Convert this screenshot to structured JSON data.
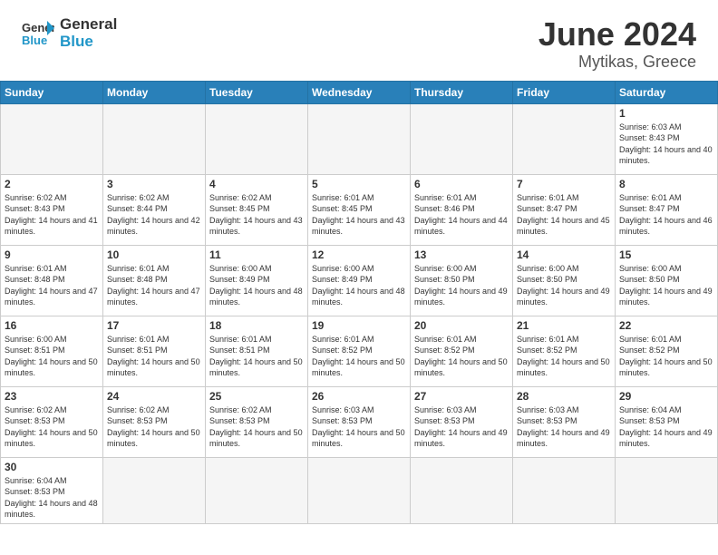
{
  "header": {
    "logo_general": "General",
    "logo_blue": "Blue",
    "title": "June 2024",
    "subtitle": "Mytikas, Greece"
  },
  "weekdays": [
    "Sunday",
    "Monday",
    "Tuesday",
    "Wednesday",
    "Thursday",
    "Friday",
    "Saturday"
  ],
  "weeks": [
    [
      {
        "day": "",
        "empty": true
      },
      {
        "day": "",
        "empty": true
      },
      {
        "day": "",
        "empty": true
      },
      {
        "day": "",
        "empty": true
      },
      {
        "day": "",
        "empty": true
      },
      {
        "day": "",
        "empty": true
      },
      {
        "day": "1",
        "sunrise": "6:03 AM",
        "sunset": "8:43 PM",
        "daylight": "14 hours and 40 minutes."
      }
    ],
    [
      {
        "day": "2",
        "sunrise": "6:02 AM",
        "sunset": "8:43 PM",
        "daylight": "14 hours and 41 minutes."
      },
      {
        "day": "3",
        "sunrise": "6:02 AM",
        "sunset": "8:44 PM",
        "daylight": "14 hours and 42 minutes."
      },
      {
        "day": "4",
        "sunrise": "6:02 AM",
        "sunset": "8:45 PM",
        "daylight": "14 hours and 43 minutes."
      },
      {
        "day": "5",
        "sunrise": "6:01 AM",
        "sunset": "8:45 PM",
        "daylight": "14 hours and 43 minutes."
      },
      {
        "day": "6",
        "sunrise": "6:01 AM",
        "sunset": "8:46 PM",
        "daylight": "14 hours and 44 minutes."
      },
      {
        "day": "7",
        "sunrise": "6:01 AM",
        "sunset": "8:47 PM",
        "daylight": "14 hours and 45 minutes."
      },
      {
        "day": "8",
        "sunrise": "6:01 AM",
        "sunset": "8:47 PM",
        "daylight": "14 hours and 46 minutes."
      }
    ],
    [
      {
        "day": "9",
        "sunrise": "6:01 AM",
        "sunset": "8:48 PM",
        "daylight": "14 hours and 47 minutes."
      },
      {
        "day": "10",
        "sunrise": "6:01 AM",
        "sunset": "8:48 PM",
        "daylight": "14 hours and 47 minutes."
      },
      {
        "day": "11",
        "sunrise": "6:00 AM",
        "sunset": "8:49 PM",
        "daylight": "14 hours and 48 minutes."
      },
      {
        "day": "12",
        "sunrise": "6:00 AM",
        "sunset": "8:49 PM",
        "daylight": "14 hours and 48 minutes."
      },
      {
        "day": "13",
        "sunrise": "6:00 AM",
        "sunset": "8:50 PM",
        "daylight": "14 hours and 49 minutes."
      },
      {
        "day": "14",
        "sunrise": "6:00 AM",
        "sunset": "8:50 PM",
        "daylight": "14 hours and 49 minutes."
      },
      {
        "day": "15",
        "sunrise": "6:00 AM",
        "sunset": "8:50 PM",
        "daylight": "14 hours and 49 minutes."
      }
    ],
    [
      {
        "day": "16",
        "sunrise": "6:00 AM",
        "sunset": "8:51 PM",
        "daylight": "14 hours and 50 minutes."
      },
      {
        "day": "17",
        "sunrise": "6:01 AM",
        "sunset": "8:51 PM",
        "daylight": "14 hours and 50 minutes."
      },
      {
        "day": "18",
        "sunrise": "6:01 AM",
        "sunset": "8:51 PM",
        "daylight": "14 hours and 50 minutes."
      },
      {
        "day": "19",
        "sunrise": "6:01 AM",
        "sunset": "8:52 PM",
        "daylight": "14 hours and 50 minutes."
      },
      {
        "day": "20",
        "sunrise": "6:01 AM",
        "sunset": "8:52 PM",
        "daylight": "14 hours and 50 minutes."
      },
      {
        "day": "21",
        "sunrise": "6:01 AM",
        "sunset": "8:52 PM",
        "daylight": "14 hours and 50 minutes."
      },
      {
        "day": "22",
        "sunrise": "6:01 AM",
        "sunset": "8:52 PM",
        "daylight": "14 hours and 50 minutes."
      }
    ],
    [
      {
        "day": "23",
        "sunrise": "6:02 AM",
        "sunset": "8:53 PM",
        "daylight": "14 hours and 50 minutes."
      },
      {
        "day": "24",
        "sunrise": "6:02 AM",
        "sunset": "8:53 PM",
        "daylight": "14 hours and 50 minutes."
      },
      {
        "day": "25",
        "sunrise": "6:02 AM",
        "sunset": "8:53 PM",
        "daylight": "14 hours and 50 minutes."
      },
      {
        "day": "26",
        "sunrise": "6:03 AM",
        "sunset": "8:53 PM",
        "daylight": "14 hours and 50 minutes."
      },
      {
        "day": "27",
        "sunrise": "6:03 AM",
        "sunset": "8:53 PM",
        "daylight": "14 hours and 49 minutes."
      },
      {
        "day": "28",
        "sunrise": "6:03 AM",
        "sunset": "8:53 PM",
        "daylight": "14 hours and 49 minutes."
      },
      {
        "day": "29",
        "sunrise": "6:04 AM",
        "sunset": "8:53 PM",
        "daylight": "14 hours and 49 minutes."
      }
    ],
    [
      {
        "day": "30",
        "sunrise": "6:04 AM",
        "sunset": "8:53 PM",
        "daylight": "14 hours and 48 minutes.",
        "lastrow": true
      },
      {
        "day": "",
        "empty": true,
        "lastrow": true
      },
      {
        "day": "",
        "empty": true,
        "lastrow": true
      },
      {
        "day": "",
        "empty": true,
        "lastrow": true
      },
      {
        "day": "",
        "empty": true,
        "lastrow": true
      },
      {
        "day": "",
        "empty": true,
        "lastrow": true
      },
      {
        "day": "",
        "empty": true,
        "lastrow": true
      }
    ]
  ]
}
